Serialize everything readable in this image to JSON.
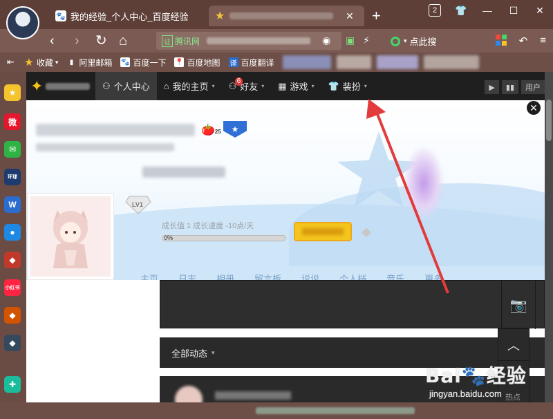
{
  "tabs": [
    {
      "title": "我的经验_个人中心_百度经验",
      "icon": "baidu-paw-icon"
    },
    {
      "title": "",
      "icon": "star-icon"
    }
  ],
  "tab_count": "2",
  "navbar": {
    "security_badge": "证",
    "site_label": "腾讯网",
    "search_engine": "点此搜",
    "search_suffix": "▾"
  },
  "bookmarks": [
    {
      "label": "收藏",
      "icon": "star-icon",
      "color": "#f5c32c"
    },
    {
      "label": "阿里邮箱",
      "icon": "doc-icon",
      "color": "#ffffff"
    },
    {
      "label": "百度一下",
      "icon": "baidu-paw-icon",
      "color": "#2b6ccf"
    },
    {
      "label": "百度地图",
      "icon": "map-pin-icon",
      "color": "#e84040"
    },
    {
      "label": "百度翻译",
      "icon": "translate-icon",
      "color": "#2b6ccf"
    }
  ],
  "sidebar_icons": [
    {
      "name": "favorites-star-icon",
      "color": "#f5c32c",
      "label": "★"
    },
    {
      "name": "weibo-icon",
      "color": "#e6162d",
      "label": "微"
    },
    {
      "name": "mail-icon",
      "color": "#2fb344",
      "label": "✉"
    },
    {
      "name": "global-net-icon",
      "color": "#1d3b6e",
      "label": "环球"
    },
    {
      "name": "word-doc-icon",
      "color": "#2b6ccf",
      "label": "W"
    },
    {
      "name": "chat-icon",
      "color": "#1e88e5",
      "label": "●"
    },
    {
      "name": "game-icon",
      "color": "#c0392b",
      "label": "◆"
    },
    {
      "name": "xiaohongshu-icon",
      "color": "#ff2442",
      "label": "小红书"
    },
    {
      "name": "game2-icon",
      "color": "#d35400",
      "label": "◆"
    },
    {
      "name": "game3-icon",
      "color": "#34495e",
      "label": "◆"
    },
    {
      "name": "plus-tool-icon",
      "color": "#1abc9c",
      "label": "✚"
    }
  ],
  "qzone_nav": {
    "items": [
      {
        "label": "个人中心",
        "icon": "person-icon",
        "active": true
      },
      {
        "label": "我的主页",
        "icon": "home-icon",
        "active": false
      },
      {
        "label": "好友",
        "icon": "friends-icon",
        "badge": "6",
        "active": false
      },
      {
        "label": "游戏",
        "icon": "grid-icon",
        "active": false
      },
      {
        "label": "装扮",
        "icon": "shirt-icon",
        "active": false
      }
    ],
    "user_label": "用户"
  },
  "profile": {
    "level": "LV1",
    "growth_text": "成长值 1  成长速度 -10点/天",
    "progress_label": "0%",
    "progress_value": 0,
    "badge_count": "25"
  },
  "profile_tabs": [
    "主页",
    "日志",
    "相册",
    "留言板",
    "说说",
    "个人档",
    "音乐",
    "更多"
  ],
  "feed": {
    "header": "全部动态",
    "hot_label": "热点"
  },
  "watermark": {
    "brand": "Bai",
    "brand2": "经验",
    "url": "jingyan.baidu.com"
  }
}
